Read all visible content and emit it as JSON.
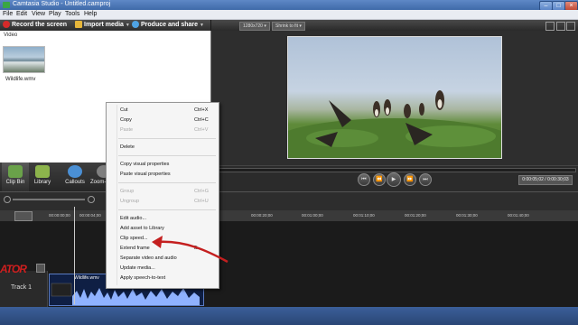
{
  "window": {
    "title": "Camtasia Studio - Untitled.camproj"
  },
  "menu": [
    "File",
    "Edit",
    "View",
    "Play",
    "Tools",
    "Help"
  ],
  "toolbar": {
    "record": "Record the screen",
    "import": "Import media",
    "produce": "Produce and share"
  },
  "preview_header": {
    "resolution": "1280x720",
    "zoom": "Shrink to fit"
  },
  "clip_bin": {
    "section": "Video",
    "clip_name": "Wildlife.wmv"
  },
  "tasks": [
    "Clip Bin",
    "Library",
    "Callouts",
    "Zoom-n-Pa"
  ],
  "playback": {
    "timecode": "0:00:05;02 / 0:00:30;03"
  },
  "ruler_ticks": [
    "00:00:00;00",
    "00:00:04;00",
    "00:00:10;00",
    "00:00:20;00",
    "00:01:00;00",
    "00:01:10;00",
    "00:01:20;00",
    "00:01:30;00",
    "00:01:40;00"
  ],
  "track": {
    "label": "Track 1",
    "clip": "Wildlife.wmv"
  },
  "logo_text": "ATOR",
  "context_menu": {
    "items": [
      {
        "label": "Cut",
        "shortcut": "Ctrl+X",
        "disabled": false
      },
      {
        "label": "Copy",
        "shortcut": "Ctrl+C",
        "disabled": false
      },
      {
        "label": "Paste",
        "shortcut": "Ctrl+V",
        "disabled": true
      },
      {
        "label": "Delete",
        "shortcut": "",
        "disabled": false
      },
      {
        "label": "Copy visual properties",
        "shortcut": "",
        "disabled": false
      },
      {
        "label": "Paste visual properties",
        "shortcut": "",
        "disabled": false
      },
      {
        "label": "Group",
        "shortcut": "Ctrl+G",
        "disabled": true
      },
      {
        "label": "Ungroup",
        "shortcut": "Ctrl+U",
        "disabled": true
      },
      {
        "label": "Edit audio...",
        "shortcut": "",
        "disabled": false
      },
      {
        "label": "Add asset to Library",
        "shortcut": "",
        "disabled": false
      },
      {
        "label": "Clip speed...",
        "shortcut": "",
        "disabled": false
      },
      {
        "label": "Extend frame",
        "shortcut": "E",
        "disabled": false
      },
      {
        "label": "Separate video and audio",
        "shortcut": "",
        "disabled": false
      },
      {
        "label": "Update media...",
        "shortcut": "",
        "disabled": false
      },
      {
        "label": "Apply speech-to-text",
        "shortcut": "",
        "disabled": false
      }
    ]
  },
  "colors": {
    "accent": "#c41f1f",
    "clip": "#0f1f44",
    "waveform": "#8fb2ff"
  }
}
